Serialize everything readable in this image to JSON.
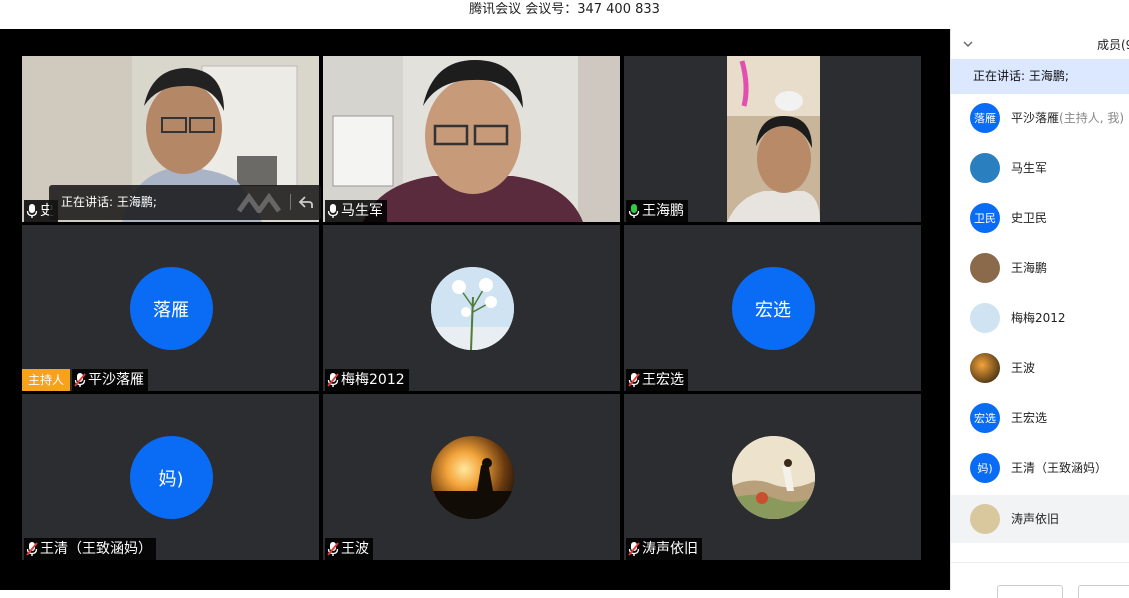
{
  "window": {
    "title": "腾讯会议 会议号：347 400 833"
  },
  "grid": {
    "speaking_toast": "正在讲话: 王海鹏;",
    "host_badge": "主持人",
    "tiles": [
      {
        "name": "史卫民",
        "visible_name": "史",
        "type": "video",
        "mic": "muted-white"
      },
      {
        "name": "马生军",
        "type": "video",
        "mic": "white"
      },
      {
        "name": "王海鹏",
        "type": "video",
        "mic": "active-green"
      },
      {
        "name": "平沙落雁",
        "type": "avatar",
        "avatar_text": "落雁",
        "mic": "muted",
        "host": true
      },
      {
        "name": "梅梅2012",
        "type": "photo",
        "avatar_icon": "lily-flower-photo",
        "mic": "muted"
      },
      {
        "name": "王宏选",
        "type": "avatar",
        "avatar_text": "宏选",
        "mic": "muted"
      },
      {
        "name": "王清（王致涵妈）",
        "type": "avatar",
        "avatar_text": "妈)",
        "mic": "muted"
      },
      {
        "name": "王波",
        "type": "photo",
        "avatar_icon": "sunset-silhouette-photo",
        "mic": "muted"
      },
      {
        "name": "涛声依旧",
        "type": "photo",
        "avatar_icon": "painting-photo",
        "mic": "muted"
      }
    ]
  },
  "sidebar": {
    "title": "成员(9",
    "speaking": "正在讲话: 王海鹏;",
    "members": [
      {
        "name": "平沙落雁",
        "suffix": "(主持人, 我)",
        "avatar_text": "落雁"
      },
      {
        "name": "马生军",
        "suffix": "",
        "avatar_text": ""
      },
      {
        "name": "史卫民",
        "suffix": "",
        "avatar_text": "卫民"
      },
      {
        "name": "王海鹏",
        "suffix": "",
        "avatar_text": ""
      },
      {
        "name": "梅梅2012",
        "suffix": "",
        "avatar_text": ""
      },
      {
        "name": "王波",
        "suffix": "",
        "avatar_text": ""
      },
      {
        "name": "王宏选",
        "suffix": "",
        "avatar_text": "宏选"
      },
      {
        "name": "王清（王致涵妈）",
        "suffix": "",
        "avatar_text": "妈)"
      },
      {
        "name": "涛声依旧",
        "suffix": "",
        "avatar_text": ""
      }
    ]
  },
  "colors": {
    "accent": "#0a6cf5",
    "host_badge": "#f7a21b",
    "mic_active": "#2ecc40",
    "tile_bg": "#2b2d30"
  }
}
